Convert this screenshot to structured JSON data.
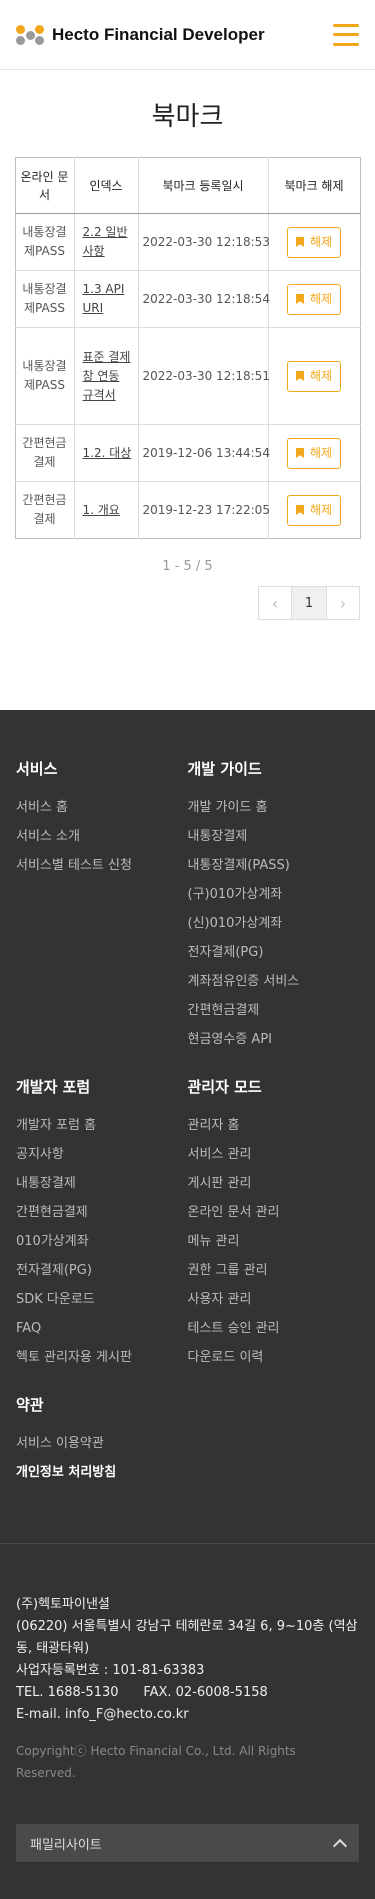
{
  "header": {
    "brand": "Hecto Financial Developer"
  },
  "page": {
    "title": "북마크"
  },
  "table": {
    "headers": [
      "온라인 문서",
      "인덱스",
      "북마크 등록일시",
      "북마크 해제"
    ],
    "rows": [
      {
        "doc": "내통장결제PASS",
        "index": "2.2 일반 사항",
        "date": "2022-03-30 12:18:53",
        "action": "해제"
      },
      {
        "doc": "내통장결제PASS",
        "index": "1.3 API URI",
        "date": "2022-03-30 12:18:54",
        "action": "해제"
      },
      {
        "doc": "내통장결제PASS",
        "index": "표준 결제창 연동 규격서",
        "date": "2022-03-30 12:18:51",
        "action": "해제"
      },
      {
        "doc": "간편현금결제",
        "index": "1.2. 대상",
        "date": "2019-12-06 13:44:54",
        "action": "해제"
      },
      {
        "doc": "간편현금결제",
        "index": "1. 개요",
        "date": "2019-12-23 17:22:05",
        "action": "해제"
      }
    ]
  },
  "pagination": {
    "range": "1 - 5 / 5",
    "current": "1"
  },
  "footer": {
    "services": {
      "title": "서비스",
      "items": [
        "서비스 홈",
        "서비스 소개",
        "서비스별 테스트 신청"
      ]
    },
    "guide": {
      "title": "개발 가이드",
      "items": [
        "개발 가이드 홈",
        "내통장결제",
        "내통장결제(PASS)",
        "(구)010가상계좌",
        "(신)010가상계좌",
        "전자결제(PG)",
        "계좌점유인증 서비스",
        "간편현금결제",
        "현금영수증 API"
      ]
    },
    "forum": {
      "title": "개발자 포럼",
      "items": [
        "개발자 포럼 홈",
        "공지사항",
        "내통장결제",
        "간편현금결제",
        "010가상계좌",
        "전자결제(PG)",
        "SDK 다운로드",
        "FAQ",
        "헥토 관리자용 게시판"
      ]
    },
    "admin": {
      "title": "관리자 모드",
      "items": [
        "관리자 홈",
        "서비스 관리",
        "게시판 관리",
        "온라인 문서 관리",
        "메뉴 관리",
        "권한 그룹 관리",
        "사용자 관리",
        "테스트 승인 관리",
        "다운로드 이력"
      ]
    },
    "terms": {
      "title": "약관",
      "items": [
        "서비스 이용약관",
        "개인정보 처리방침"
      ]
    },
    "company": {
      "name": "(주)헥토파이낸셜",
      "address": "(06220) 서울특별시 강남구 테헤란로 34길 6, 9~10층 (역삼동, 태광타워)",
      "bizno": "사업자등록번호 : 101-81-63383",
      "contact": "TEL. 1688-5130      FAX. 02-6008-5158",
      "email": "E-mail. info_F@hecto.co.kr",
      "copyright": "Copyrightⓒ Hecto Financial Co., Ltd. All Rights Reserved."
    },
    "family": "패밀리사이트"
  }
}
